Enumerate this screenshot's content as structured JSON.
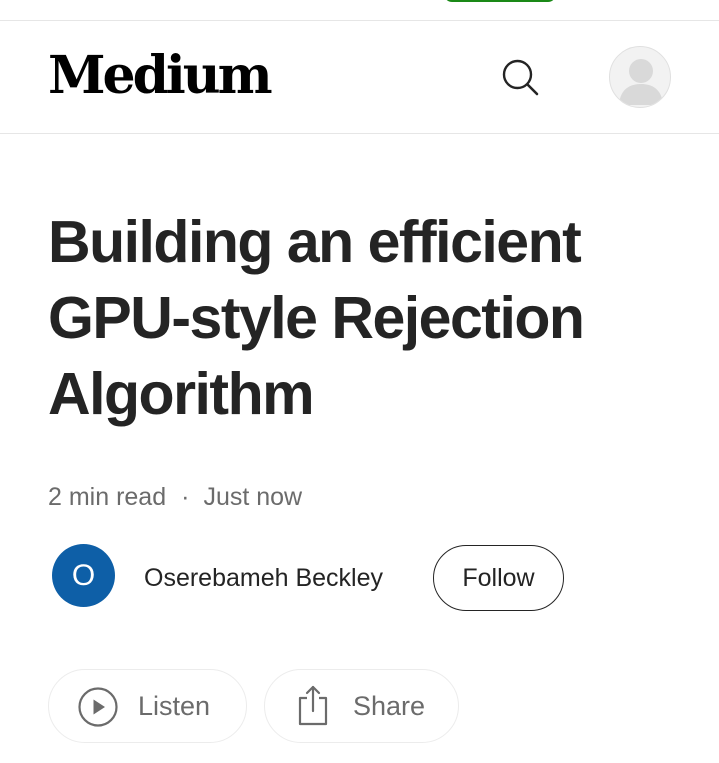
{
  "header": {
    "logo": "Medium",
    "search_icon": "search-icon",
    "avatar_icon": "user-avatar-icon"
  },
  "article": {
    "title": "Building an efficient GPU-style Rejection Algorithm",
    "read_time": "2 min read",
    "separator": "·",
    "published": "Just now"
  },
  "author": {
    "initial": "O",
    "name": "Oserebameh Beckley",
    "follow_label": "Follow",
    "avatar_color": "#0e5fa7"
  },
  "actions": {
    "listen_label": "Listen",
    "listen_icon": "play-circle-icon",
    "share_label": "Share",
    "share_icon": "share-icon"
  },
  "colors": {
    "text": "#242424",
    "muted": "#6b6b6b",
    "accent_green": "#1a8917"
  }
}
